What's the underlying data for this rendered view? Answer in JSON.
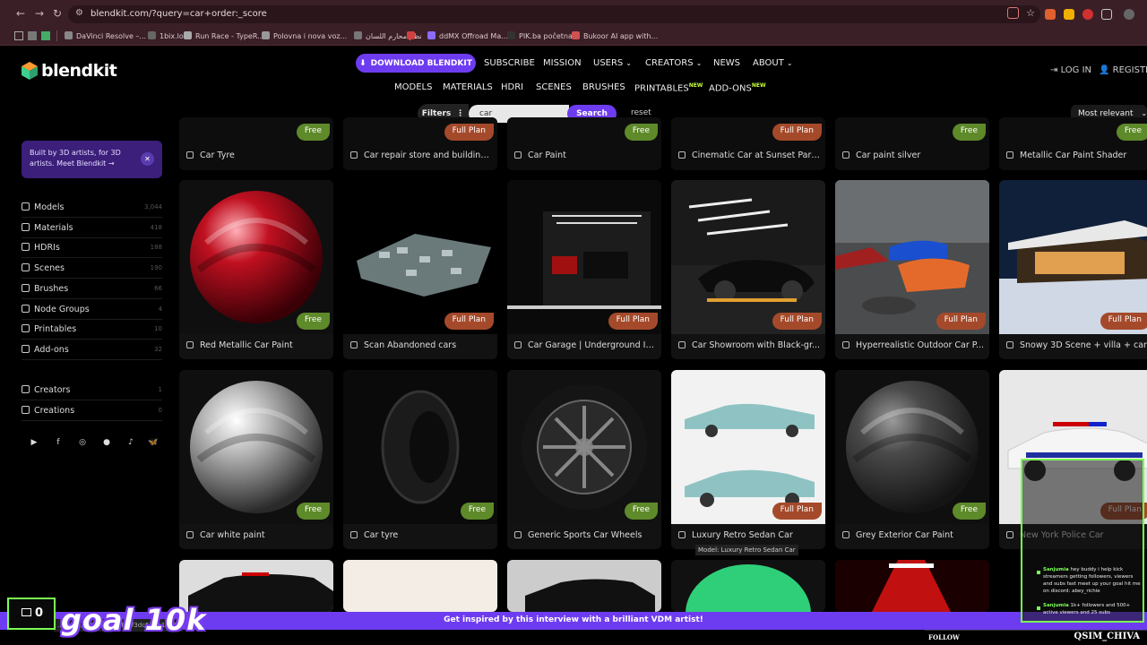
{
  "browser": {
    "url": "blendkit.com/?query=car+order:_score",
    "bookmarks": [
      {
        "label": "DaVinci Resolve –...",
        "color": "#888888"
      },
      {
        "label": "1bix.loi",
        "color": "#666666"
      },
      {
        "label": "Run Race - TypeR...",
        "color": "#aaaaaa"
      },
      {
        "label": "Polovna i nova voz...",
        "color": "#999999"
      },
      {
        "label": "نظم محارم اللسان",
        "color": "#777777"
      },
      {
        "label": "",
        "color": "#d04040"
      },
      {
        "label": "ddMX Offroad Ma...",
        "color": "#8a6cff"
      },
      {
        "label": "PIK.ba početna",
        "color": "#333333"
      },
      {
        "label": "Bukoor AI app with...",
        "color": "#d05050"
      }
    ]
  },
  "header": {
    "logo": "blendkit",
    "download_label": "DOWNLOAD BLENDKIT",
    "top_nav": [
      {
        "label": "SUBSCRIBE",
        "chevron": false
      },
      {
        "label": "MISSION",
        "chevron": false
      },
      {
        "label": "USERS",
        "chevron": true
      },
      {
        "label": "CREATORS",
        "chevron": true
      },
      {
        "label": "NEWS",
        "chevron": false
      },
      {
        "label": "ABOUT",
        "chevron": true
      }
    ],
    "sub_nav": [
      {
        "label": "MODELS",
        "badge": ""
      },
      {
        "label": "MATERIALS",
        "badge": ""
      },
      {
        "label": "HDRI",
        "badge": ""
      },
      {
        "label": "SCENES",
        "badge": ""
      },
      {
        "label": "BRUSHES",
        "badge": ""
      },
      {
        "label": "PRINTABLES",
        "badge": "NEW"
      },
      {
        "label": "ADD-ONS",
        "badge": "NEW"
      }
    ],
    "login_label": "LOG IN",
    "register_label": "REGISTE"
  },
  "search": {
    "filters_label": "Filters",
    "query": "car",
    "search_label": "Search",
    "reset_label": "reset",
    "sort_label": "Most relevant"
  },
  "sidebar": {
    "promo_text": "Built by 3D artists, for 3D artists. Meet Blendkit →",
    "categories": [
      {
        "label": "Models",
        "count": "3,044"
      },
      {
        "label": "Materials",
        "count": "418"
      },
      {
        "label": "HDRIs",
        "count": "188"
      },
      {
        "label": "Scenes",
        "count": "190"
      },
      {
        "label": "Brushes",
        "count": "66"
      },
      {
        "label": "Node Groups",
        "count": "4"
      },
      {
        "label": "Printables",
        "count": "10"
      },
      {
        "label": "Add-ons",
        "count": "32"
      }
    ],
    "extra": [
      {
        "label": "Creators",
        "count": "1"
      },
      {
        "label": "Creations",
        "count": "0"
      }
    ],
    "social_icons": [
      "youtube-icon",
      "facebook-icon",
      "instagram-icon",
      "github-icon",
      "tiktok-icon",
      "bluesky-icon"
    ]
  },
  "cards_row0": [
    {
      "title": "Car Tyre",
      "badge": "Free"
    },
    {
      "title": "Car repair store and building...",
      "badge": "Full Plan"
    },
    {
      "title": "Car Paint",
      "badge": "Free"
    },
    {
      "title": "Cinematic Car at Sunset Park...",
      "badge": "Full Plan"
    },
    {
      "title": "Car paint silver",
      "badge": "Free"
    },
    {
      "title": "Metallic Car Paint Shader",
      "badge": "Free"
    }
  ],
  "cards_row1": [
    {
      "title": "Red Metallic Car Paint",
      "badge": "Free"
    },
    {
      "title": "Scan Abandoned cars",
      "badge": "Full Plan"
    },
    {
      "title": "Car Garage | Underground In...",
      "badge": "Full Plan"
    },
    {
      "title": "Car Showroom with Black-gr...",
      "badge": "Full Plan"
    },
    {
      "title": "Hyperrealistic Outdoor Car P...",
      "badge": "Full Plan"
    },
    {
      "title": "Snowy 3D Scene + villa + car",
      "badge": "Full Plan"
    }
  ],
  "cards_row2": [
    {
      "title": "Car white paint",
      "badge": "Free"
    },
    {
      "title": "Car tyre",
      "badge": "Free"
    },
    {
      "title": "Generic Sports Car Wheels",
      "badge": "Free"
    },
    {
      "title": "Luxury Retro Sedan Car",
      "badge": "Full Plan"
    },
    {
      "title": "Grey Exterior Car Paint",
      "badge": "Free"
    },
    {
      "title": "New York Police Car",
      "badge": "Full Plan"
    }
  ],
  "tooltip": "Model: Luxury Retro Sedan Car",
  "bottom_banner": "Get inspired by this interview with a brilliant VDM artist!",
  "status_url": "...detail/...6-4108-a1b5-f3dc528b1310/",
  "stream": {
    "counter": "0",
    "goal": "goal 10k",
    "follow_label": "FOLLOW",
    "username": "QSIM_CHIVA",
    "chat": [
      {
        "user": "Sanjumia",
        "text": "hey buddy i help kick streamers getting followers, viewers and subs fast meet up your goal hit me on discord: abey_richie"
      },
      {
        "user": "Sanjumia",
        "text": "1k+ followers and 500+ active viewers and 25 subs"
      }
    ]
  }
}
